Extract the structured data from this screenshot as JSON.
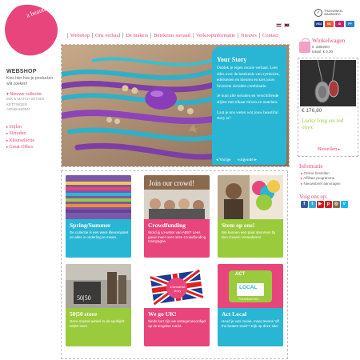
{
  "logo": {
    "text": "a beautiful story"
  },
  "nav": {
    "items": [
      "Webshop",
      "Ons verhaal",
      "De makers",
      "Betekenis sieraad",
      "Verkoopinformatie",
      "Nieuws",
      "Contact"
    ]
  },
  "badges": {
    "thuiswinkel": "THUISWINKEL WAARBORG",
    "payments": [
      "VISA",
      "MC",
      "iD",
      "PP"
    ]
  },
  "sidebar": {
    "title": "WEBSHOP",
    "subtitle": "Kies hier hoe je producten wilt zoeken!",
    "categories": [
      {
        "label": "Nieuwe collectie",
        "active": true
      },
      {
        "label": "MIX & MATCH SETJES",
        "sub": true
      },
      {
        "label": "KETTINGEN",
        "sub": true
      },
      {
        "label": "ARMBANDEN",
        "sub": true
      }
    ],
    "links": [
      "Stijlen",
      "Sieraden",
      "Kleurselectie",
      "Great Offers"
    ]
  },
  "hero": {
    "title": "Your Story",
    "paragraphs": [
      "Ontdek je eigen mooie verhaal. Lees alles over de betekenis van symbolen, edelstenen en kleuren en kies jouw favoriete sieraden combinatie.",
      "Je kunt alle sieraden en verschillende stijlen met elkaar mixen en matchen.",
      "Laat je ons weten wat jouw beautiful story is?"
    ],
    "prev": "Vorige",
    "next": "volgende"
  },
  "cart": {
    "title": "Winkelwagen",
    "items_count": "0",
    "items_label": "artikelen",
    "total_label": "totaal",
    "total_value": "€ 0,00"
  },
  "product": {
    "price": "€ 176,80",
    "name": "Lucky long set red onyx",
    "cta": "Bestellen"
  },
  "info": {
    "title": "Informatie",
    "items": [
      "Online bestellen",
      "Affiliate programma",
      "Nieuwsbrief aanvragen"
    ]
  },
  "follow": {
    "title": "Volg ons op:",
    "networks": [
      "facebook-icon",
      "twitter-icon",
      "youtube-icon",
      "pinterest-icon",
      "instagram-icon",
      "vimeo-icon"
    ]
  },
  "tiles": [
    {
      "title": "Spring/Summer",
      "text": "De collectie is een ware kleurenpalet en alles is onderling te mixen.",
      "color": "#29b6d4"
    },
    {
      "title": "Crowdfunding",
      "text": "Word jij co-writer van ABS? Lees gauw meer over onze Crowdfunding Campagne.",
      "color": "#e8457c",
      "banner": "Join our crowd!"
    },
    {
      "title": "Stem op ons!",
      "text": "We kunnen een paar stemmen bij Ben Gewen Veranderen!",
      "color": "#9acb3c"
    },
    {
      "title": "50|50 store",
      "text": "Deze maand winkel in de spotlight: 50|50 store",
      "color": "#9acb3c",
      "sign": "50|50"
    },
    {
      "title": "We go UK!",
      "text": "Sinds kort zijn we vertegenwoordigd op de Engelse markt.",
      "color": "#e8457c",
      "stamp": "a beautiful story"
    },
    {
      "title": "Act Local",
      "text": "Houd je van mooie, maar tevens 'off the beaten track'? Kijk op deze site!",
      "color": "#29b6d4",
      "badge_top": "ACT",
      "badge_main": "LOCAL",
      "badge_sub": "FOUNDATION"
    }
  ]
}
